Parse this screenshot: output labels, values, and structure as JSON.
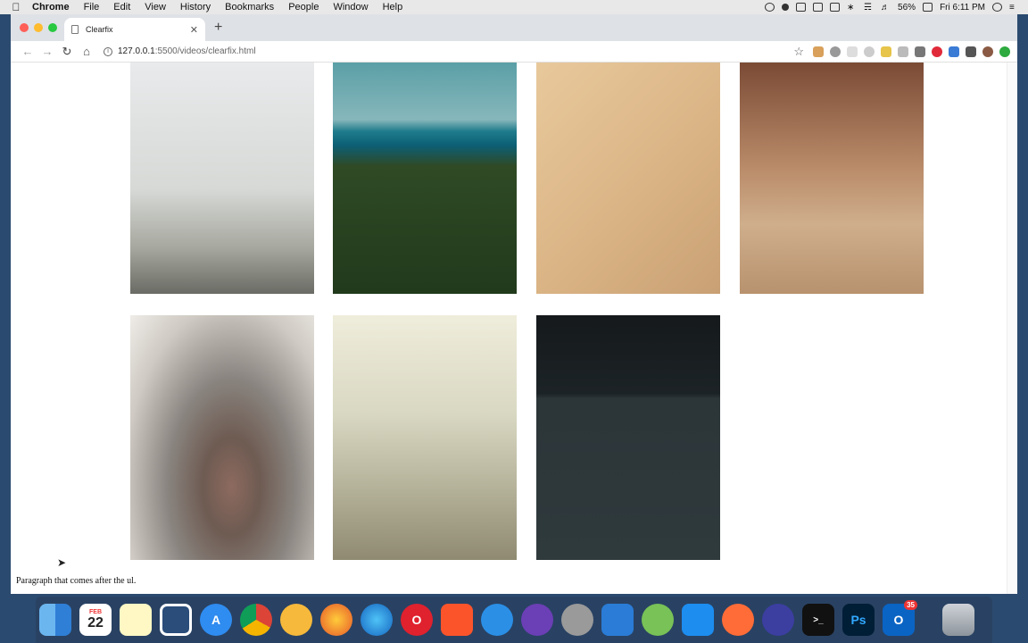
{
  "menubar": {
    "app_name": "Chrome",
    "menus": [
      "File",
      "Edit",
      "View",
      "History",
      "Bookmarks",
      "People",
      "Window",
      "Help"
    ],
    "battery": "56%",
    "clock": "Fri 6:11 PM"
  },
  "browser": {
    "tab_title": "Clearfix",
    "url_host": "127.0.0.1",
    "url_path": ":5500/videos/clearfix.html"
  },
  "page": {
    "images": [
      {
        "subject": "foggy tree-lined road"
      },
      {
        "subject": "lake and forest"
      },
      {
        "subject": "desk with notebook and phone"
      },
      {
        "subject": "red coffee mug"
      },
      {
        "subject": "cat nose close-up"
      },
      {
        "subject": "bird on boat rope"
      },
      {
        "subject": "dark desk with keyboard"
      }
    ],
    "paragraph": "Paragraph that comes after the ul."
  },
  "dock": {
    "calendar_month": "FEB",
    "calendar_day": "22",
    "outlook_badge": "35",
    "apps": [
      "Finder",
      "Calendar",
      "Notes",
      "Brackets",
      "App Store",
      "Chrome",
      "Chrome Canary",
      "Firefox",
      "Firefox Developer Edition",
      "Opera",
      "Brave",
      "Safari",
      "Safari Technology Preview",
      "ImageOptim",
      "VS Code",
      "Android Studio",
      "Xcode",
      "Postman",
      "Night Owl",
      "Terminal",
      "Photoshop",
      "Outlook",
      "Trash"
    ]
  },
  "colors": {
    "tab_strip": "#dee1e6",
    "page_bg": "#ffffff",
    "desktop": "#2b4a6f"
  }
}
